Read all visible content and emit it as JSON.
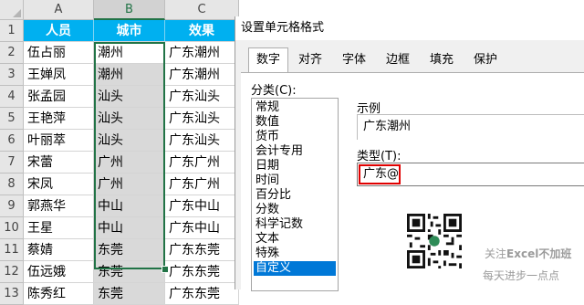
{
  "sheet": {
    "columns": [
      "A",
      "B",
      "C"
    ],
    "rows": [
      "1",
      "2",
      "3",
      "4",
      "5",
      "6",
      "7",
      "8",
      "9",
      "10",
      "11",
      "12",
      "13"
    ],
    "header": [
      "人员",
      "城市",
      "效果"
    ],
    "data": [
      [
        "伍占丽",
        "潮州",
        "广东潮州"
      ],
      [
        "王婵凤",
        "潮州",
        "广东潮州"
      ],
      [
        "张孟园",
        "汕头",
        "广东汕头"
      ],
      [
        "王艳萍",
        "汕头",
        "广东汕头"
      ],
      [
        "叶丽萃",
        "汕头",
        "广东汕头"
      ],
      [
        "宋蕾",
        "广州",
        "广东广州"
      ],
      [
        "宋凤",
        "广州",
        "广东广州"
      ],
      [
        "郭燕华",
        "中山",
        "广东中山"
      ],
      [
        "王星",
        "中山",
        "广东中山"
      ],
      [
        "蔡婧",
        "东莞",
        "广东东莞"
      ],
      [
        "伍远娥",
        "东莞",
        "广东东莞"
      ],
      [
        "陈秀红",
        "东莞",
        "广东东莞"
      ]
    ]
  },
  "dialog": {
    "title": "设置单元格格式",
    "tabs": [
      "数字",
      "对齐",
      "字体",
      "边框",
      "填充",
      "保护"
    ],
    "active_tab": "数字",
    "category_label": "分类(C):",
    "categories": [
      "常规",
      "数值",
      "货币",
      "会计专用",
      "日期",
      "时间",
      "百分比",
      "分数",
      "科学记数",
      "文本",
      "特殊",
      "自定义"
    ],
    "selected_category": "自定义",
    "sample_label": "示例",
    "sample_value": "广东潮州",
    "type_label": "类型(T):",
    "type_value": "广东@"
  },
  "watermark": {
    "line1_prefix": "关注",
    "line1_brand": "Excel不加班",
    "line2": "每天进步一点点"
  },
  "colors": {
    "header_fill": "#00b0f0",
    "selection_border": "#217346",
    "selected_category": "#0078d7",
    "type_highlight": "#e00000"
  }
}
